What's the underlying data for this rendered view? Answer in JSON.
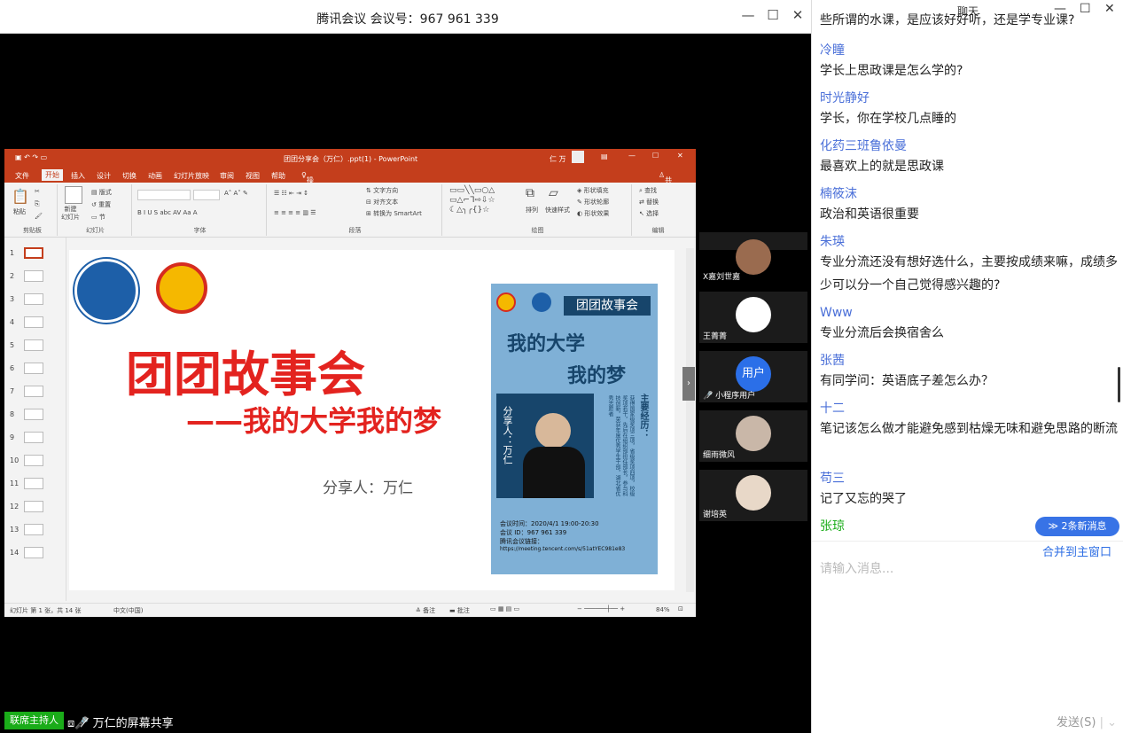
{
  "meeting": {
    "title": "腾讯会议 会议号：967 961 339",
    "host_badge": "联席主持人",
    "share_label": "万仁的屏幕共享"
  },
  "ppt": {
    "title": "团团分享会（万仁）.ppt(1) - PowerPoint",
    "user": "仁 万",
    "share_btn": "共享",
    "tabs": [
      "文件",
      "开始",
      "插入",
      "设计",
      "切换",
      "动画",
      "幻灯片放映",
      "审阅",
      "视图",
      "帮助",
      "操作说明搜索"
    ],
    "groups": [
      "剪贴板",
      "幻灯片",
      "字体",
      "段落",
      "绘图",
      "编辑"
    ],
    "ribbon": {
      "paste": "粘贴",
      "new_slide": "新建\n幻灯片",
      "layout": "版式",
      "reset": "重置",
      "section": "节",
      "text_dir": "文字方向",
      "align_text": "对齐文本",
      "smartart": "转换为 SmartArt",
      "arrange": "排列",
      "quick_styles": "快速样式",
      "shape_fill": "形状填充",
      "shape_outline": "形状轮廓",
      "shape_effect": "形状效果",
      "find": "查找",
      "replace": "替换",
      "select": "选择"
    },
    "thumb_numbers": [
      "1",
      "2",
      "3",
      "4",
      "5",
      "6",
      "7",
      "8",
      "9",
      "10",
      "11",
      "12",
      "13",
      "14"
    ],
    "status": {
      "slide_info": "幻灯片 第 1 张，共 14 张",
      "language": "中文(中国)",
      "notes": "备注",
      "comments": "批注",
      "zoom": "84%"
    }
  },
  "slide": {
    "heading": "团团故事会",
    "subheading": "——我的大学我的梦",
    "sharer": "分享人：万仁",
    "poster": {
      "header": "团团故事会",
      "title1": "我的大学",
      "title2": "我的梦",
      "sharer_vertical": "分享人：万仁",
      "experience_title": "主要经历：",
      "experience_text": "获得国家级奖项三项，省级奖项四项，校级奖项若干，先后在组织部担任部长，参与科技创新，荣获年度优秀学生干部，湖北省优秀志愿者",
      "meeting_time": "会议时间：2020/4/1 19:00-20:30",
      "meeting_id": "会议 ID：967 961 339",
      "meeting_link_label": "腾讯会议链接：",
      "meeting_link": "https://meeting.tencent.com/s/51atYEC981e83"
    }
  },
  "participants": [
    {
      "name": "X嘉刘世嘉"
    },
    {
      "name": "王菁菁"
    },
    {
      "name": "小程序用户",
      "avatar_text": "用户"
    },
    {
      "name": "细雨微风"
    },
    {
      "name": "谢培英"
    }
  ],
  "chat": {
    "title": "聊天",
    "partial_top": "些所谓的水课，是应该好好听，还是学专业课?",
    "messages": [
      {
        "user": "冷瞳",
        "text": "学长上思政课是怎么学的?"
      },
      {
        "user": "时光静好",
        "text": "学长，你在学校几点睡的"
      },
      {
        "user": "化药三班鲁依曼",
        "text": "最喜欢上的就是思政课"
      },
      {
        "user": "楠筱沫",
        "text": "政治和英语很重要"
      },
      {
        "user": "朱瑛",
        "text": "专业分流还没有想好选什么，主要按成绩来嘛，成绩多少可以分一个自己觉得感兴趣的?"
      },
      {
        "user": "Www",
        "text": "专业分流后会换宿舍么"
      },
      {
        "user": "张茜",
        "text": "有同学问：英语底子差怎么办？"
      },
      {
        "user": "十二",
        "text": "笔记该怎么做才能避免感到枯燥无味和避免思路的断流"
      },
      {
        "user": "苟三",
        "text": "记了又忘的哭了"
      }
    ],
    "last_user": "张琼",
    "new_messages": "≫ 2条新消息",
    "merge": "合并到主窗口",
    "placeholder": "请输入消息...",
    "send": "发送(S)"
  },
  "colors": {
    "ppt_red": "#c43e1c",
    "slide_red": "#e3231f",
    "poster_blue": "#17456b",
    "poster_bg": "#7fb0d6",
    "link": "#4a6fd8",
    "host_green": "#1aac19"
  }
}
